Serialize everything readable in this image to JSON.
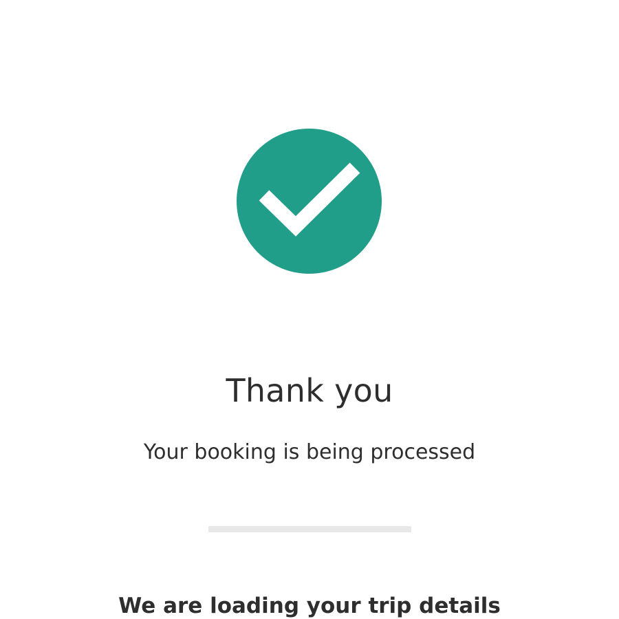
{
  "confirmation": {
    "icon": "checkmark-icon",
    "accent_color": "#219e8a",
    "title": "Thank you",
    "subtitle": "Your booking is being processed"
  },
  "loading": {
    "progress": 0,
    "track_color": "#e8e8e8",
    "message": "We are loading your trip details"
  }
}
